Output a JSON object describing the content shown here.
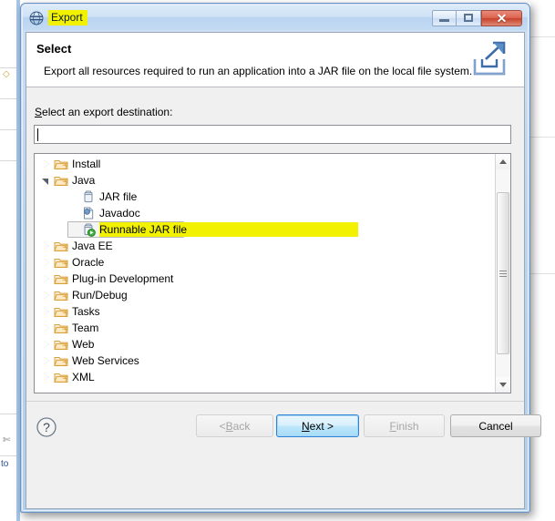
{
  "window": {
    "title": "Export",
    "title_icon": "eclipse-globe-icon",
    "title_highlight_color": "#f2f200",
    "controls": {
      "minimize_label": "Minimize",
      "maximize_label": "Maximize",
      "close_label": "Close",
      "close_glyph": "✕"
    }
  },
  "banner": {
    "title": "Select",
    "description": "Export all resources required to run an application into a JAR file on the local file system.",
    "icon": "export-wizard-icon"
  },
  "form": {
    "label_prefix": "S",
    "label_rest": "elect an export destination:",
    "destination": {
      "value": "",
      "placeholder": ""
    }
  },
  "tree": {
    "selected": "Runnable JAR file",
    "selection_highlight_color": "#f2f200",
    "items": [
      {
        "label": "Install",
        "indent": 0,
        "twisty": "collapsed",
        "icon": "folder-icon",
        "selected": false
      },
      {
        "label": "Java",
        "indent": 0,
        "twisty": "expanded",
        "icon": "folder-icon",
        "selected": false
      },
      {
        "label": "JAR file",
        "indent": 1,
        "twisty": "none",
        "icon": "jar-file-icon",
        "selected": false
      },
      {
        "label": "Javadoc",
        "indent": 1,
        "twisty": "none",
        "icon": "javadoc-icon",
        "selected": false
      },
      {
        "label": "Runnable JAR file",
        "indent": 1,
        "twisty": "none",
        "icon": "runnable-jar-icon",
        "selected": true
      },
      {
        "label": "Java EE",
        "indent": 0,
        "twisty": "collapsed",
        "icon": "folder-icon",
        "selected": false
      },
      {
        "label": "Oracle",
        "indent": 0,
        "twisty": "collapsed",
        "icon": "folder-icon",
        "selected": false
      },
      {
        "label": "Plug-in Development",
        "indent": 0,
        "twisty": "collapsed",
        "icon": "folder-icon",
        "selected": false
      },
      {
        "label": "Run/Debug",
        "indent": 0,
        "twisty": "collapsed",
        "icon": "folder-icon",
        "selected": false
      },
      {
        "label": "Tasks",
        "indent": 0,
        "twisty": "collapsed",
        "icon": "folder-icon",
        "selected": false
      },
      {
        "label": "Team",
        "indent": 0,
        "twisty": "collapsed",
        "icon": "folder-icon",
        "selected": false
      },
      {
        "label": "Web",
        "indent": 0,
        "twisty": "collapsed",
        "icon": "folder-icon",
        "selected": false
      },
      {
        "label": "Web Services",
        "indent": 0,
        "twisty": "collapsed",
        "icon": "folder-icon",
        "selected": false
      },
      {
        "label": "XML",
        "indent": 0,
        "twisty": "collapsed",
        "icon": "folder-icon",
        "selected": false
      }
    ]
  },
  "scrollbar": {
    "up_arrow": "scroll-up-icon",
    "down_arrow": "scroll-down-icon"
  },
  "buttons": {
    "help": "?",
    "back": {
      "prefix": "< ",
      "mnemonic": "B",
      "rest": "ack",
      "enabled": false,
      "default": false
    },
    "next": {
      "prefix": "",
      "mnemonic": "N",
      "rest": "ext >",
      "enabled": true,
      "default": true
    },
    "finish": {
      "prefix": "",
      "mnemonic": "F",
      "rest": "inish",
      "enabled": false,
      "default": false
    },
    "cancel": {
      "prefix": "",
      "mnemonic": "",
      "rest": "Cancel",
      "enabled": true,
      "default": false
    }
  }
}
